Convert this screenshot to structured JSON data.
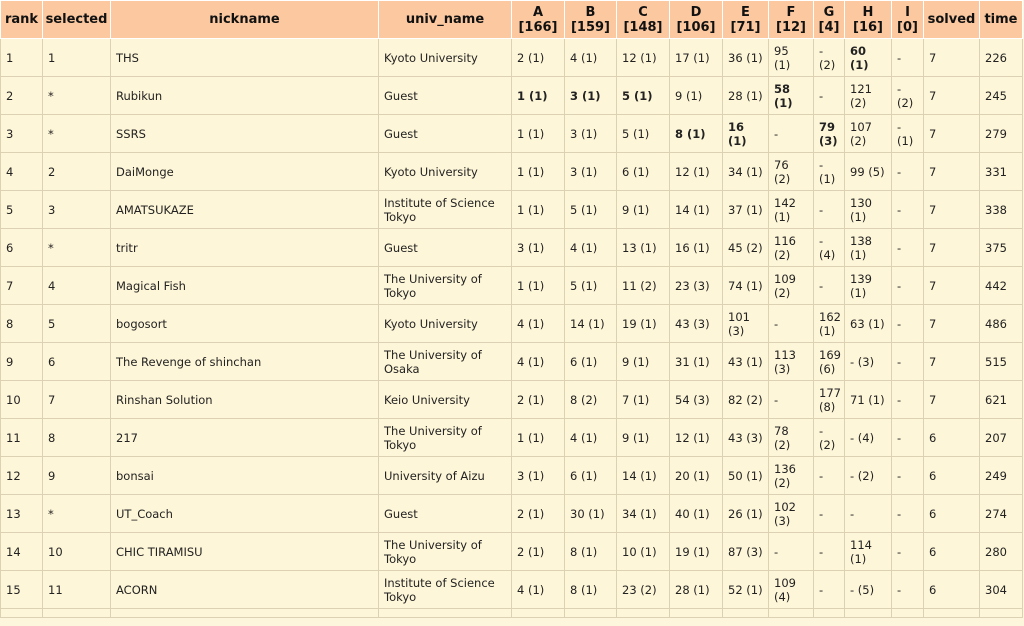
{
  "columns": [
    "rank",
    "selected",
    "nickname",
    "univ_name",
    "A\n[166]",
    "B\n[159]",
    "C\n[148]",
    "D\n[106]",
    "E\n[71]",
    "F\n[12]",
    "G\n[4]",
    "H\n[16]",
    "I\n[0]",
    "solved",
    "time"
  ],
  "rows": [
    [
      "1",
      "1",
      "THS",
      "Kyoto University",
      "2 (1)",
      "4 (1)",
      "12 (1)",
      "17 (1)",
      "36 (1)",
      "95 (1)",
      "- (2)",
      "60 (1)",
      "-",
      "7",
      "226"
    ],
    [
      "2",
      "*",
      "Rubikun",
      "Guest",
      "1 (1)",
      "3 (1)",
      "5 (1)",
      "9 (1)",
      "28 (1)",
      "58 (1)",
      "-",
      "121 (2)",
      "- (2)",
      "7",
      "245"
    ],
    [
      "3",
      "*",
      "SSRS",
      "Guest",
      "1 (1)",
      "3 (1)",
      "5 (1)",
      "8 (1)",
      "16 (1)",
      "-",
      "79 (3)",
      "107 (2)",
      "- (1)",
      "7",
      "279"
    ],
    [
      "4",
      "2",
      "DaiMonge",
      "Kyoto University",
      "1 (1)",
      "3 (1)",
      "6 (1)",
      "12 (1)",
      "34 (1)",
      "76 (2)",
      "- (1)",
      "99 (5)",
      "-",
      "7",
      "331"
    ],
    [
      "5",
      "3",
      "AMATSUKAZE",
      "Institute of Science Tokyo",
      "1 (1)",
      "5 (1)",
      "9 (1)",
      "14 (1)",
      "37 (1)",
      "142 (1)",
      "-",
      "130 (1)",
      "-",
      "7",
      "338"
    ],
    [
      "6",
      "*",
      "tritr",
      "Guest",
      "3 (1)",
      "4 (1)",
      "13 (1)",
      "16 (1)",
      "45 (2)",
      "116 (2)",
      "- (4)",
      "138 (1)",
      "-",
      "7",
      "375"
    ],
    [
      "7",
      "4",
      "Magical Fish",
      "The University of Tokyo",
      "1 (1)",
      "5 (1)",
      "11 (2)",
      "23 (3)",
      "74 (1)",
      "109 (2)",
      "-",
      "139 (1)",
      "-",
      "7",
      "442"
    ],
    [
      "8",
      "5",
      "bogosort",
      "Kyoto University",
      "4 (1)",
      "14 (1)",
      "19 (1)",
      "43 (3)",
      "101 (3)",
      "-",
      "162 (1)",
      "63 (1)",
      "-",
      "7",
      "486"
    ],
    [
      "9",
      "6",
      "The Revenge of shinchan",
      "The University of Osaka",
      "4 (1)",
      "6 (1)",
      "9 (1)",
      "31 (1)",
      "43 (1)",
      "113 (3)",
      "169 (6)",
      "- (3)",
      "-",
      "7",
      "515"
    ],
    [
      "10",
      "7",
      "Rinshan Solution",
      "Keio University",
      "2 (1)",
      "8 (2)",
      "7 (1)",
      "54 (3)",
      "82 (2)",
      "-",
      "177 (8)",
      "71 (1)",
      "-",
      "7",
      "621"
    ],
    [
      "11",
      "8",
      "217",
      "The University of Tokyo",
      "1 (1)",
      "4 (1)",
      "9 (1)",
      "12 (1)",
      "43 (3)",
      "78 (2)",
      "- (2)",
      "- (4)",
      "-",
      "6",
      "207"
    ],
    [
      "12",
      "9",
      "bonsai",
      "University of Aizu",
      "3 (1)",
      "6 (1)",
      "14 (1)",
      "20 (1)",
      "50 (1)",
      "136 (2)",
      "-",
      "- (2)",
      "-",
      "6",
      "249"
    ],
    [
      "13",
      "*",
      "UT_Coach",
      "Guest",
      "2 (1)",
      "30 (1)",
      "34 (1)",
      "40 (1)",
      "26 (1)",
      "102 (3)",
      "-",
      "-",
      "-",
      "6",
      "274"
    ],
    [
      "14",
      "10",
      "CHIC TIRAMISU",
      "The University of Tokyo",
      "2 (1)",
      "8 (1)",
      "10 (1)",
      "19 (1)",
      "87 (3)",
      "-",
      "-",
      "114 (1)",
      "-",
      "6",
      "280"
    ],
    [
      "15",
      "11",
      "ACORN",
      "Institute of Science Tokyo",
      "4 (1)",
      "8 (1)",
      "23 (2)",
      "28 (1)",
      "52 (1)",
      "109 (4)",
      "-",
      "- (5)",
      "-",
      "6",
      "304"
    ]
  ],
  "first_solves": [
    [
      0,
      11
    ],
    [
      1,
      4
    ],
    [
      1,
      5
    ],
    [
      1,
      6
    ],
    [
      1,
      9
    ],
    [
      2,
      7
    ],
    [
      2,
      8
    ],
    [
      2,
      10
    ]
  ]
}
